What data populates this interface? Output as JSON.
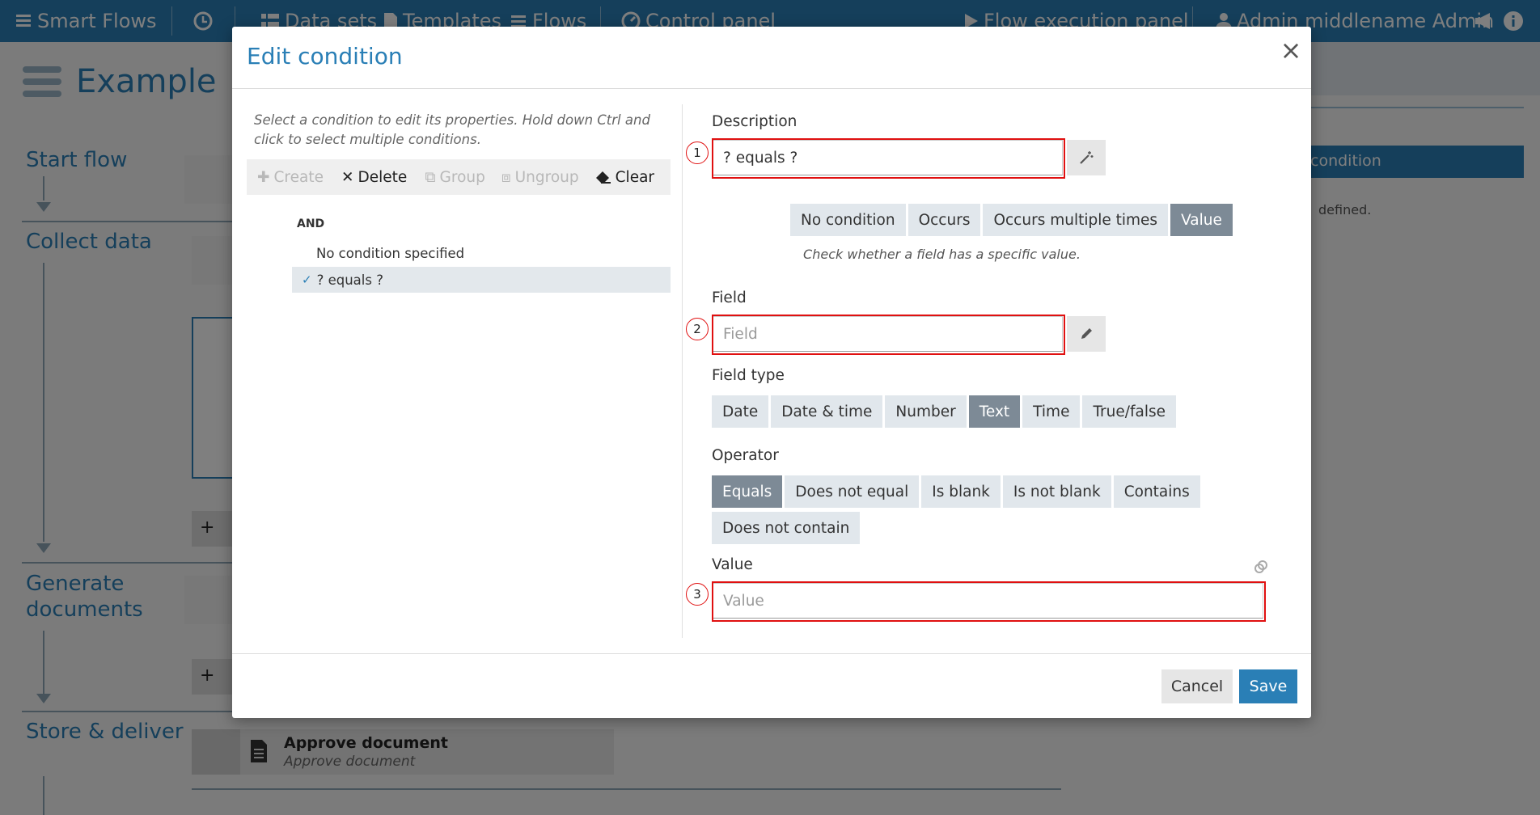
{
  "nav": {
    "brand": "Smart Flows",
    "datasets": "Data sets",
    "templates": "Templates",
    "flows": "Flows",
    "control_panel": "Control panel",
    "execution_panel": "Flow execution panel",
    "user": "Admin middlename Admin"
  },
  "background": {
    "page_title": "Example",
    "sections": {
      "start": "Start flow",
      "collect": "Collect data",
      "generate": "Generate documents",
      "store": "Store & deliver"
    },
    "step_title": "Approve document",
    "step_subtitle": "Approve document",
    "side_button": "condition",
    "side_note": "defined."
  },
  "modal": {
    "title": "Edit condition",
    "hint": "Select a condition to edit its properties. Hold down Ctrl and click to select multiple conditions.",
    "toolbar": {
      "create": "Create",
      "delete": "Delete",
      "group": "Group",
      "ungroup": "Ungroup",
      "clear": "Clear"
    },
    "tree": {
      "operator": "AND",
      "items": [
        {
          "label": "No condition specified",
          "selected": false
        },
        {
          "label": "? equals ?",
          "selected": true
        }
      ]
    },
    "description": {
      "label": "Description",
      "value": "? equals ?"
    },
    "condition_types": {
      "options": [
        "No condition",
        "Occurs",
        "Occurs multiple times",
        "Value"
      ],
      "selected": "Value",
      "hint": "Check whether a field has a specific value."
    },
    "field": {
      "label": "Field",
      "placeholder": "Field"
    },
    "field_type": {
      "label": "Field type",
      "options": [
        "Date",
        "Date & time",
        "Number",
        "Text",
        "Time",
        "True/false"
      ],
      "selected": "Text"
    },
    "operator": {
      "label": "Operator",
      "options_row1": [
        "Equals",
        "Does not equal",
        "Is blank",
        "Is not blank",
        "Contains"
      ],
      "options_row2": [
        "Does not contain"
      ],
      "selected": "Equals"
    },
    "value": {
      "label": "Value",
      "placeholder": "Value"
    },
    "annotations": [
      "1",
      "2",
      "3"
    ],
    "cancel": "Cancel",
    "save": "Save"
  },
  "colors": {
    "brand": "#2a7fb6",
    "selected_segment": "#7d8a96",
    "annotation": "#e01010"
  }
}
